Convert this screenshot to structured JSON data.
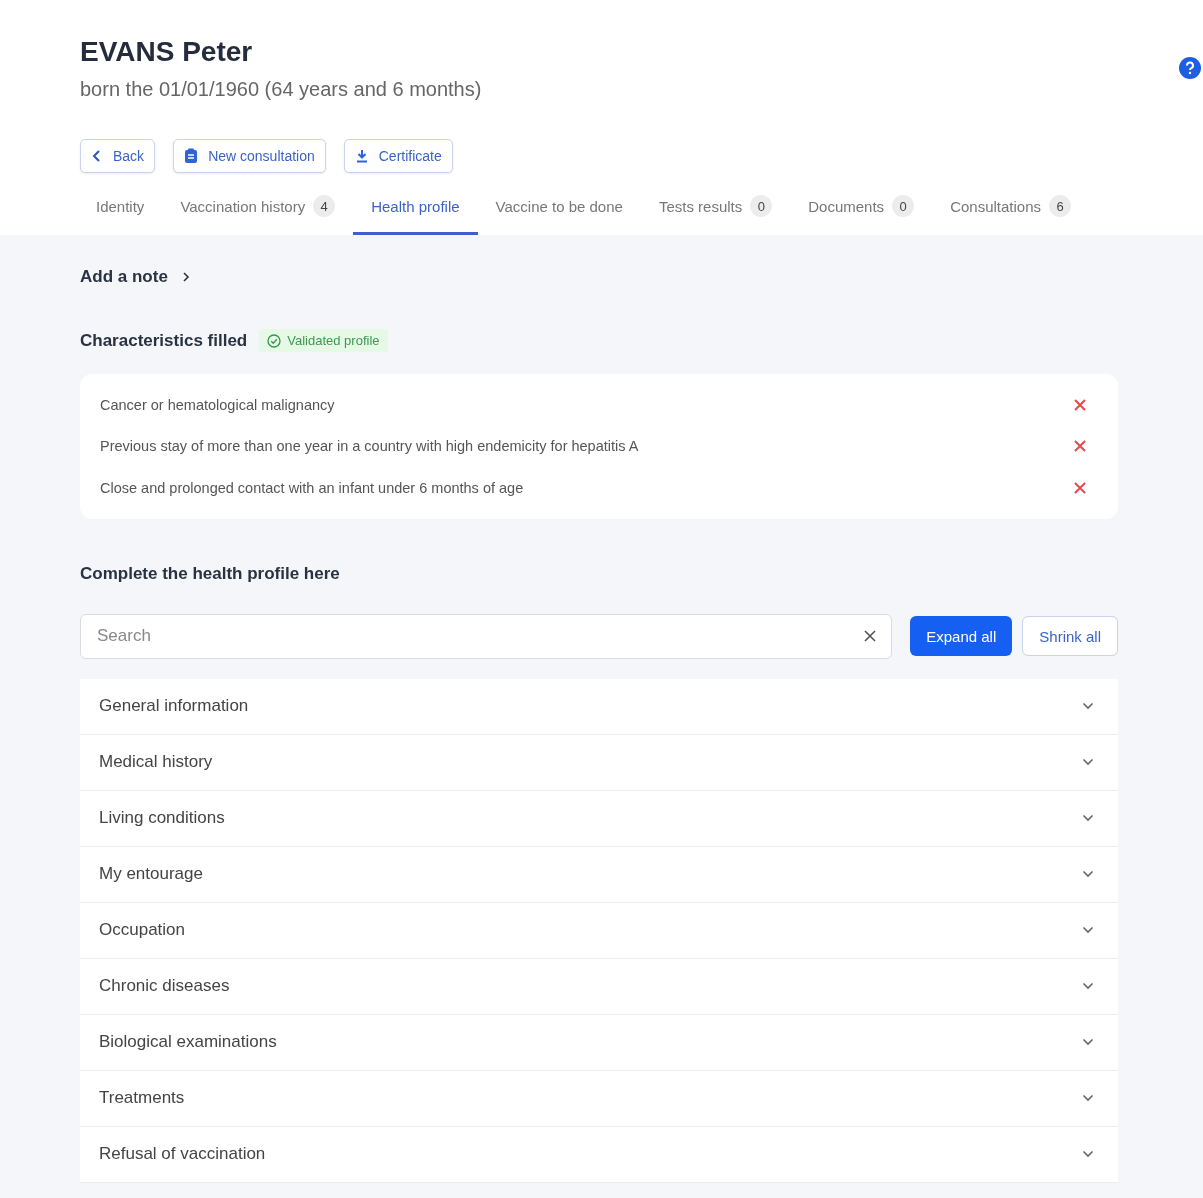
{
  "patient": {
    "name": "EVANS Peter",
    "birth": "born the 01/01/1960 (64 years and 6 months)"
  },
  "actions": [
    {
      "kind": "back",
      "label": "Back"
    },
    {
      "kind": "consultation",
      "label": "New consultation"
    },
    {
      "kind": "download",
      "label": "Certificate"
    }
  ],
  "tabs": [
    {
      "label": "Identity",
      "selected": false
    },
    {
      "label": "Vaccination history",
      "count": "4",
      "selected": false
    },
    {
      "label": "Health profile",
      "selected": true
    },
    {
      "label": "Vaccine to be done",
      "selected": false
    },
    {
      "label": "Tests results",
      "count": "0",
      "selected": false
    },
    {
      "label": "Documents",
      "count": "0",
      "selected": false
    },
    {
      "label": "Consultations",
      "count": "6",
      "selected": false
    }
  ],
  "note_link": "Add a note",
  "characteristics": {
    "title": "Characteristics filled",
    "badge": "Validated profile",
    "items": [
      "Cancer or hematological malignancy",
      "Previous stay of more than one year in a country with high endemicity for hepatitis A",
      "Close and prolonged contact with an infant under 6 months of age"
    ]
  },
  "complete": {
    "title": "Complete the health profile here",
    "search": {
      "placeholder": "Search"
    },
    "buttons": [
      {
        "kind": "primary",
        "label": "Expand all"
      },
      {
        "kind": "secondary",
        "label": "Shrink all"
      }
    ],
    "sections": [
      {
        "label": "General information",
        "expanded": false
      },
      {
        "label": "Medical history",
        "expanded": false
      },
      {
        "label": "Living conditions",
        "expanded": false
      },
      {
        "label": "My entourage",
        "expanded": false
      },
      {
        "label": "Occupation",
        "expanded": false
      },
      {
        "label": "Chronic diseases",
        "expanded": false
      },
      {
        "label": "Biological examinations",
        "expanded": false
      },
      {
        "label": "Treatments",
        "expanded": false
      },
      {
        "label": "Refusal of vaccination",
        "expanded": false
      }
    ]
  }
}
